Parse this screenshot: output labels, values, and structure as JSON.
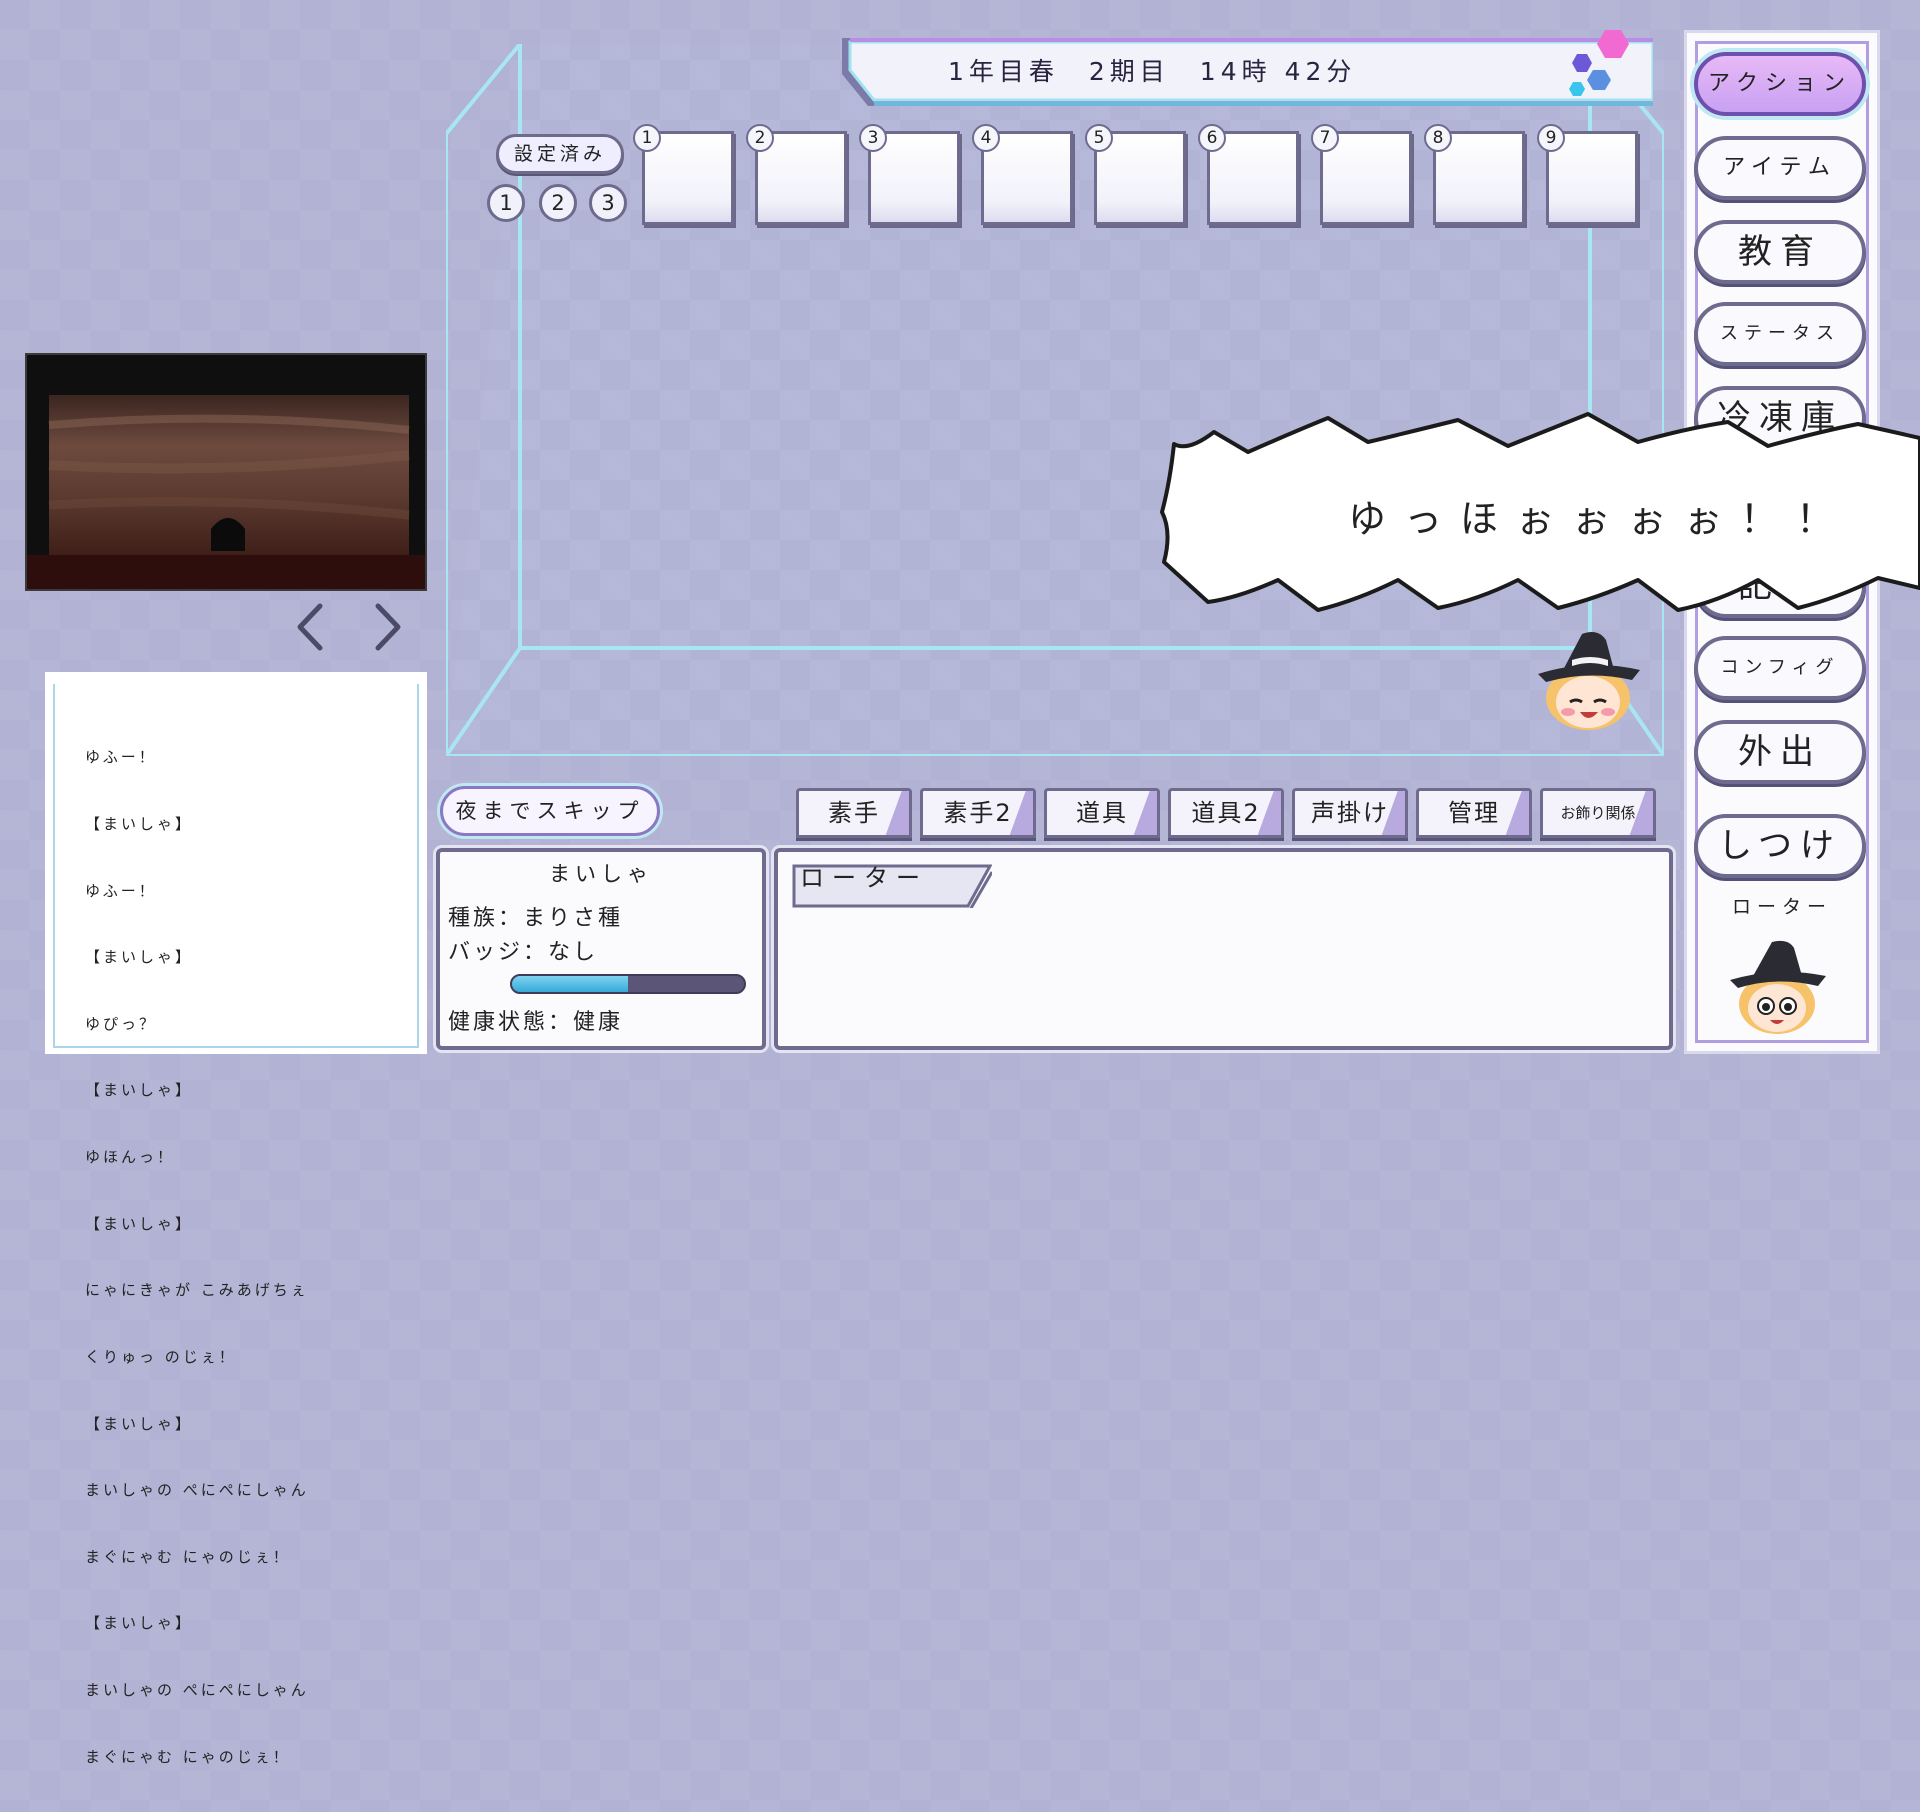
{
  "date_banner": {
    "text": "1年目春　2期目　14時 42分"
  },
  "settings": {
    "label": "設定済み",
    "presets": [
      "1",
      "2",
      "3"
    ]
  },
  "slots": [
    "1",
    "2",
    "3",
    "4",
    "5",
    "6",
    "7",
    "8",
    "9"
  ],
  "scene": {
    "prev_icon": "chevron-left-icon",
    "next_icon": "chevron-right-icon"
  },
  "log": {
    "lines": [
      "ゆふー！",
      "【まいしゃ】",
      "ゆふー！",
      "【まいしゃ】",
      "ゆぴっ？",
      "【まいしゃ】",
      "ゆほんっ！",
      "【まいしゃ】",
      "にゃにきゃが こみあげちぇ",
      "くりゅっ のじぇ！",
      "【まいしゃ】",
      "まいしゃの ぺにぺにしゃん",
      "まぐにゃむ にゃのじぇ！",
      "【まいしゃ】",
      "まいしゃの ぺにぺにしゃん",
      "まぐにゃむ にゃのじぇ！"
    ]
  },
  "skip_button": {
    "label": "夜までスキップ"
  },
  "tabs": [
    "素手",
    "素手2",
    "道具",
    "道具2",
    "声掛け",
    "管理",
    "お飾り関係"
  ],
  "status": {
    "name": "まいしゃ",
    "species": "種族：まりさ種",
    "badge": "バッジ：なし",
    "health": "健康状態：健康",
    "health_level": 0.5
  },
  "detail": {
    "tag": "ローター"
  },
  "menu": {
    "buttons": [
      "アクション",
      "アイテム",
      "教育",
      "ステータス",
      "冷凍庫",
      "記録",
      "コンフィグ",
      "外出",
      "しつけ"
    ],
    "selected_name": "ローター"
  },
  "speech": {
    "text": "ゆっほぉぉぉぉ！！"
  },
  "colors": {
    "background": "#b1b2d4",
    "accent": "#b19ee0",
    "frame": "#6e6b8f",
    "glass": "#9fe3f0"
  }
}
